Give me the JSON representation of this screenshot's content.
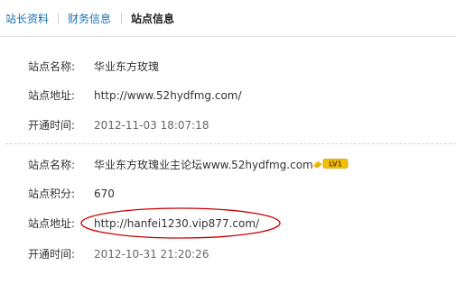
{
  "tabs": [
    {
      "label": "站长资料",
      "active": false
    },
    {
      "label": "财务信息",
      "active": false
    },
    {
      "label": "站点信息",
      "active": true
    }
  ],
  "site1": {
    "name_label": "站点名称:",
    "name_value": "华业东方玫瑰",
    "url_label": "站点地址:",
    "url_value": "http://www.52hydfmg.com/",
    "time_label": "开通时间:",
    "time_value": "2012-11-03 18:07:18"
  },
  "site2": {
    "name_label": "站点名称:",
    "name_value": "华业东方玫瑰业主论坛www.52hydfmg.com",
    "level_badge": "LV1",
    "points_label": "站点积分:",
    "points_value": "670",
    "url_label": "站点地址:",
    "url_value": "http://hanfei1230.vip877.com/",
    "time_label": "开通时间:",
    "time_value": "2012-10-31 21:20:26"
  },
  "colors": {
    "tab_link": "#1a6fb3",
    "badge_yellow": "#f2c200",
    "annotation_oval": "#cc0000"
  },
  "icons": {
    "level_badge": "level-badge-icon"
  }
}
